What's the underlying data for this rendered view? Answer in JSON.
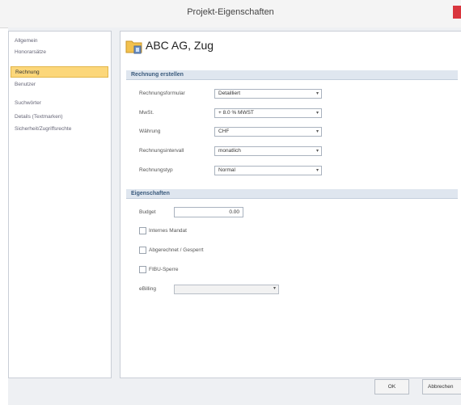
{
  "window": {
    "title": "Projekt-Eigenschaften"
  },
  "nav": {
    "items": [
      {
        "label": "Allgemein",
        "active": false
      },
      {
        "label": "Honorarsätze",
        "active": false
      },
      {
        "label": "Rechnung",
        "active": true
      },
      {
        "label": "Benutzer",
        "active": false
      },
      {
        "label": "Suchwörter",
        "active": false
      },
      {
        "label": "Details (Textmarken)",
        "active": false
      },
      {
        "label": "Sicherheit/Zugriffsrechte",
        "active": false
      }
    ]
  },
  "project": {
    "title": "ABC AG, Zug",
    "icon": "folder-icon"
  },
  "invoice": {
    "section_title": "Rechnung erstellen",
    "fields": [
      {
        "label": "Rechnungsformular",
        "value": "Detailliert"
      },
      {
        "label": "MwSt.",
        "value": "+ 8.0 % MWST"
      },
      {
        "label": "Währung",
        "value": "CHF"
      },
      {
        "label": "Rechnungsintervall",
        "value": "monatlich"
      },
      {
        "label": "Rechnungstyp",
        "value": "Normal"
      }
    ]
  },
  "properties": {
    "section_title": "Eigenschaften",
    "budget": {
      "label": "Budget",
      "value": "0.00"
    },
    "checkboxes": [
      {
        "label": "Internes Mandat",
        "checked": false
      },
      {
        "label": "Abgerechnet / Gesperrt",
        "checked": false
      },
      {
        "label": "FIBU-Sperre",
        "checked": false
      }
    ],
    "ebilling": {
      "label": "eBilling",
      "value": ""
    }
  },
  "buttons": {
    "ok": "OK",
    "cancel": "Abbrechen"
  },
  "colors": {
    "active_nav": "#fcd77a",
    "section_bg": "#dfe6ef",
    "close": "#d9363e"
  }
}
